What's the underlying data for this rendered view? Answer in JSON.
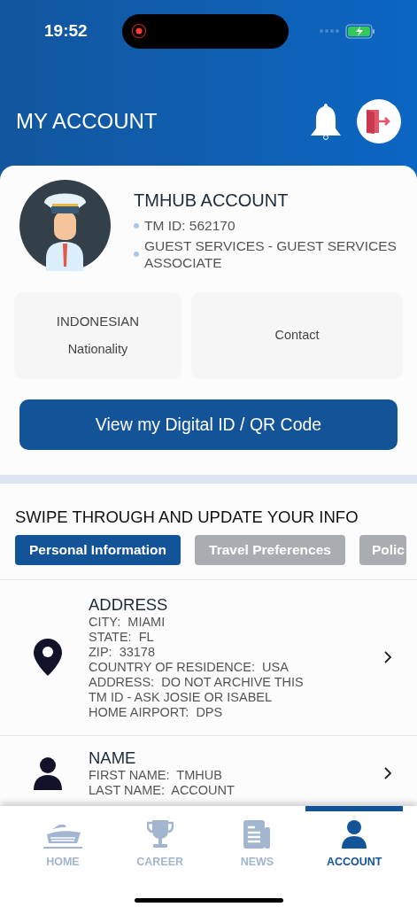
{
  "status_bar": {
    "time": "19:52"
  },
  "header": {
    "title": "MY ACCOUNT"
  },
  "profile": {
    "name": "TMHUB ACCOUNT",
    "details": [
      "TM ID: 562170",
      "GUEST SERVICES - GUEST SERVICES ASSOCIATE"
    ]
  },
  "info_tiles": [
    {
      "value": "INDONESIAN",
      "label": "Nationality"
    },
    {
      "label": "Contact"
    }
  ],
  "digital_id_button": "View my Digital ID / QR Code",
  "section_title": "SWIPE THROUGH AND UPDATE YOUR INFO",
  "tabs": [
    {
      "label": "Personal Information",
      "selected": true
    },
    {
      "label": "Travel Preferences",
      "selected": false
    },
    {
      "label": "Polic",
      "selected": false
    }
  ],
  "rows": [
    {
      "kind": "address",
      "title": "ADDRESS",
      "lines": [
        "CITY:  MIAMI",
        "STATE:  FL",
        "ZIP:  33178",
        "COUNTRY OF RESIDENCE:  USA",
        "ADDRESS:  DO NOT ARCHIVE THIS TM ID - ASK JOSIE OR ISABEL",
        "HOME AIRPORT:  DPS"
      ]
    },
    {
      "kind": "person",
      "title": "NAME",
      "lines": [
        "FIRST NAME:  TMHUB",
        "LAST NAME:  ACCOUNT"
      ]
    }
  ],
  "nav": [
    {
      "kind": "ship",
      "label": "HOME",
      "selected": false
    },
    {
      "kind": "trophy",
      "label": "CAREER",
      "selected": false
    },
    {
      "kind": "news",
      "label": "NEWS",
      "selected": false
    },
    {
      "kind": "person",
      "label": "ACCOUNT",
      "selected": true
    }
  ]
}
